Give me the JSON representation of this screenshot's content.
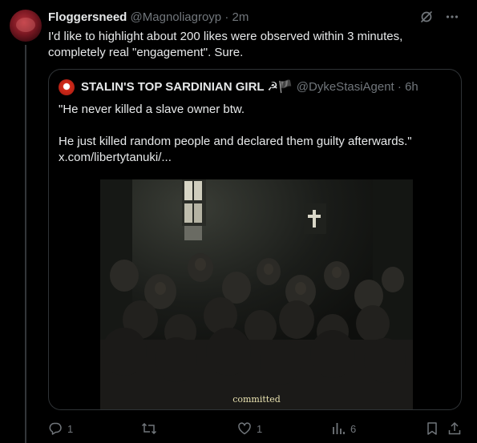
{
  "author": {
    "display_name": "Floggersneed",
    "handle": "@Magnoliagroyp",
    "separator": "·",
    "time": "2m"
  },
  "tweet": {
    "text_line1": "I'd like to highlight about 200 likes were observed within 3 minutes,",
    "text_line2": "completely real \"engagement\". Sure."
  },
  "quoted": {
    "display_name": "STALIN'S TOP SARDINIAN GIRL ☭🏴",
    "handle": "@DykeStasiAgent",
    "separator": "·",
    "time": "6h",
    "line1": "\"He never killed a slave owner btw.",
    "line2": "He just killed random people and declared them guilty afterwards.\"",
    "link": "x.com/libertytanuki/...",
    "media_caption": "committed"
  },
  "actions": {
    "reply_count": "1",
    "repost_count": "",
    "like_count": "1",
    "view_count": "6"
  },
  "colors": {
    "background": "#000000",
    "text": "#e7e9ea",
    "muted": "#71767b",
    "border": "#2f3336"
  },
  "icons": [
    "grok-icon",
    "more-icon",
    "reply-icon",
    "repost-icon",
    "like-icon",
    "views-icon",
    "bookmark-icon",
    "share-icon"
  ]
}
